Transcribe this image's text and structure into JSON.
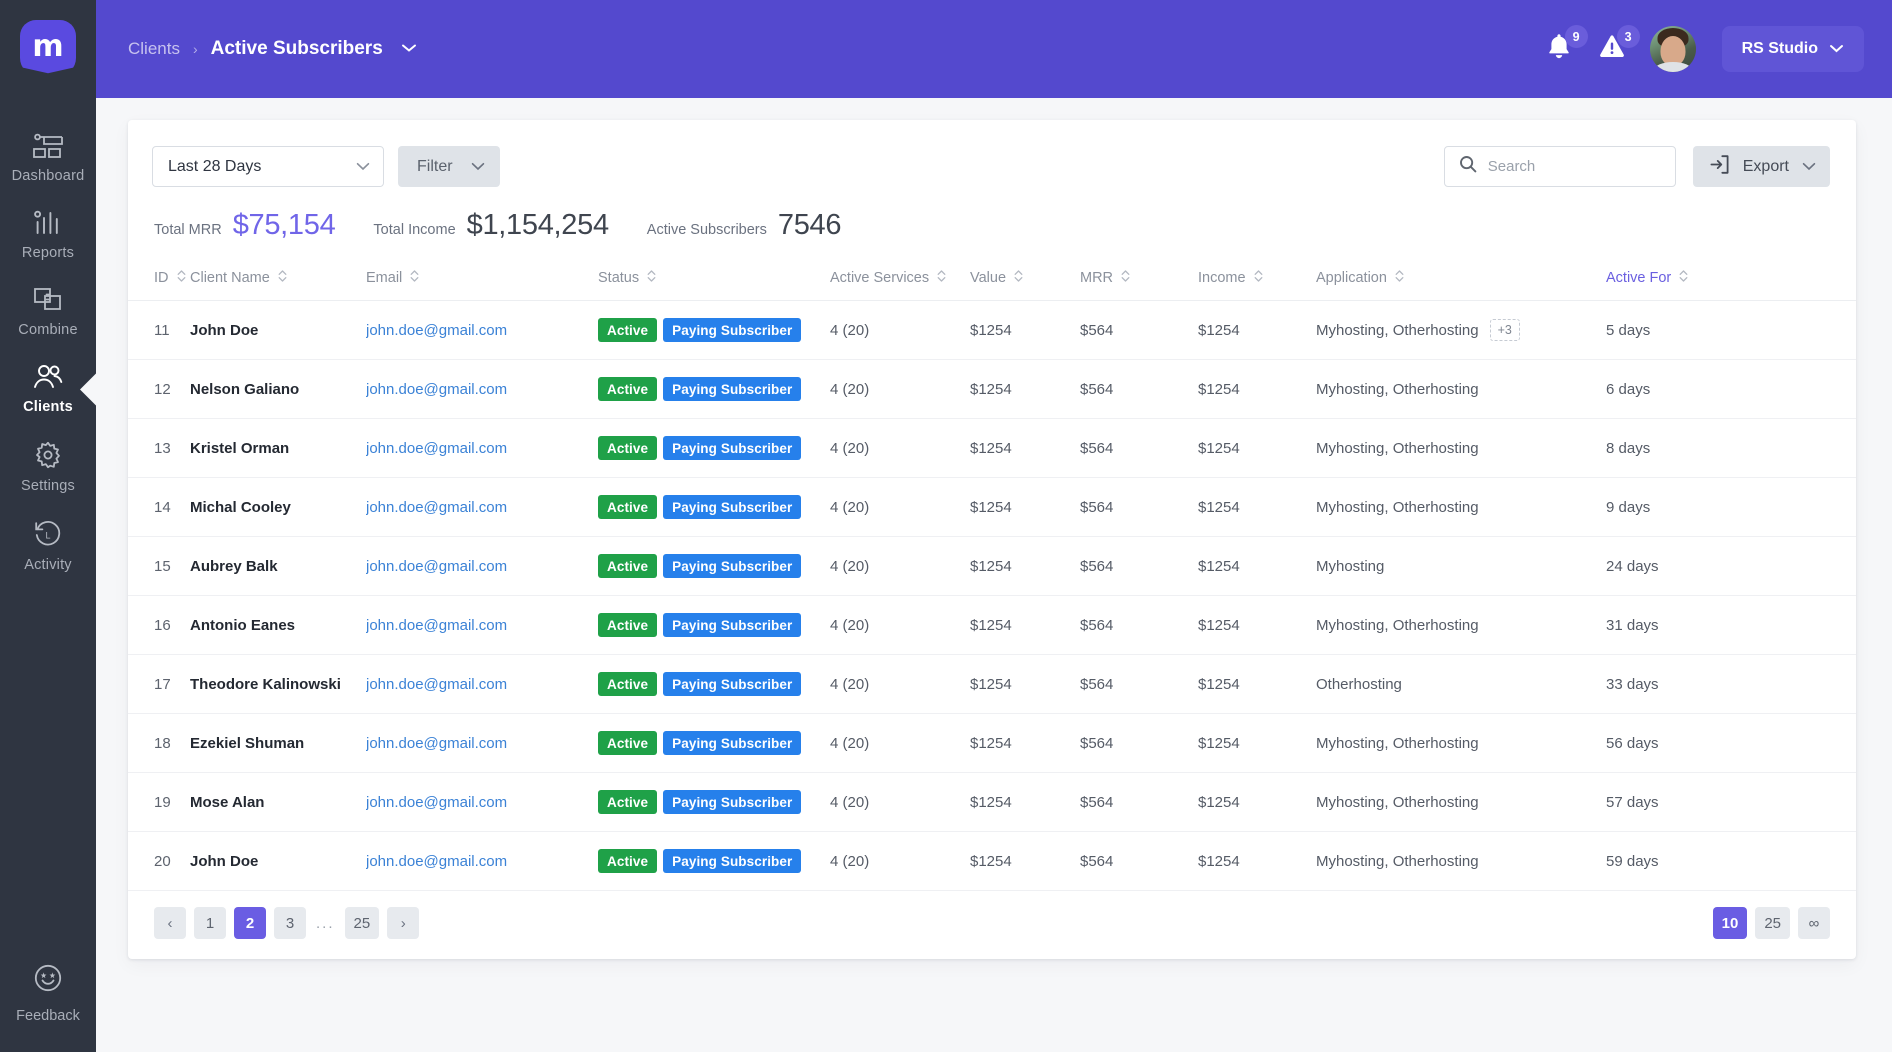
{
  "sidebar": {
    "logo_letter": "m",
    "items": [
      {
        "label": "Dashboard",
        "icon": "dashboard-icon",
        "active": false
      },
      {
        "label": "Reports",
        "icon": "reports-icon",
        "active": false
      },
      {
        "label": "Combine",
        "icon": "combine-icon",
        "active": false
      },
      {
        "label": "Clients",
        "icon": "clients-icon",
        "active": true
      },
      {
        "label": "Settings",
        "icon": "settings-gear-icon",
        "active": false
      },
      {
        "label": "Activity",
        "icon": "activity-history-icon",
        "active": false
      }
    ],
    "feedback": {
      "label": "Feedback",
      "icon": "feedback-smiley-icon"
    }
  },
  "topbar": {
    "breadcrumb_root": "Clients",
    "breadcrumb_separator": "›",
    "breadcrumb_current": "Active Subscribers",
    "notifications_count": "9",
    "alerts_count": "3",
    "workspace": "RS Studio",
    "accent_color": "#5449ce"
  },
  "toolbar": {
    "date_range": "Last 28 Days",
    "filter_label": "Filter",
    "search_placeholder": "Search",
    "search_value": "",
    "export_label": "Export"
  },
  "stats": [
    {
      "key": "Total MRR",
      "value": "$75,154",
      "accent": true
    },
    {
      "key": "Total Income",
      "value": "$1,154,254",
      "accent": false
    },
    {
      "key": "Active Subscribers",
      "value": "7546",
      "accent": false
    }
  ],
  "table": {
    "columns": [
      {
        "label": "ID",
        "sortable": true,
        "highlight": false
      },
      {
        "label": "Client Name",
        "sortable": true,
        "highlight": false
      },
      {
        "label": "Email",
        "sortable": true,
        "highlight": false
      },
      {
        "label": "Status",
        "sortable": true,
        "highlight": false
      },
      {
        "label": "Active Services",
        "sortable": true,
        "highlight": false
      },
      {
        "label": "Value",
        "sortable": true,
        "highlight": false
      },
      {
        "label": "MRR",
        "sortable": true,
        "highlight": false
      },
      {
        "label": "Income",
        "sortable": true,
        "highlight": false
      },
      {
        "label": "Application",
        "sortable": true,
        "highlight": false
      },
      {
        "label": "Active For",
        "sortable": true,
        "highlight": true
      }
    ],
    "rows": [
      {
        "id": "11",
        "name": "John Doe",
        "email": "john.doe@gmail.com",
        "status": "Active",
        "plan": "Paying Subscriber",
        "services": "4 (20)",
        "value": "$1254",
        "mrr": "$564",
        "income": "$1254",
        "application": "Myhosting, Otherhosting",
        "more": "+3",
        "active_for": "5 days"
      },
      {
        "id": "12",
        "name": "Nelson Galiano",
        "email": "john.doe@gmail.com",
        "status": "Active",
        "plan": "Paying Subscriber",
        "services": "4 (20)",
        "value": "$1254",
        "mrr": "$564",
        "income": "$1254",
        "application": "Myhosting, Otherhosting",
        "more": "",
        "active_for": "6 days"
      },
      {
        "id": "13",
        "name": "Kristel Orman",
        "email": "john.doe@gmail.com",
        "status": "Active",
        "plan": "Paying Subscriber",
        "services": "4 (20)",
        "value": "$1254",
        "mrr": "$564",
        "income": "$1254",
        "application": "Myhosting, Otherhosting",
        "more": "",
        "active_for": "8 days"
      },
      {
        "id": "14",
        "name": "Michal Cooley",
        "email": "john.doe@gmail.com",
        "status": "Active",
        "plan": "Paying Subscriber",
        "services": "4 (20)",
        "value": "$1254",
        "mrr": "$564",
        "income": "$1254",
        "application": "Myhosting, Otherhosting",
        "more": "",
        "active_for": "9 days"
      },
      {
        "id": "15",
        "name": "Aubrey Balk",
        "email": "john.doe@gmail.com",
        "status": "Active",
        "plan": "Paying Subscriber",
        "services": "4 (20)",
        "value": "$1254",
        "mrr": "$564",
        "income": "$1254",
        "application": "Myhosting",
        "more": "",
        "active_for": "24 days"
      },
      {
        "id": "16",
        "name": "Antonio Eanes",
        "email": "john.doe@gmail.com",
        "status": "Active",
        "plan": "Paying Subscriber",
        "services": "4 (20)",
        "value": "$1254",
        "mrr": "$564",
        "income": "$1254",
        "application": "Myhosting, Otherhosting",
        "more": "",
        "active_for": "31 days"
      },
      {
        "id": "17",
        "name": "Theodore Kalinowski",
        "email": "john.doe@gmail.com",
        "status": "Active",
        "plan": "Paying Subscriber",
        "services": "4 (20)",
        "value": "$1254",
        "mrr": "$564",
        "income": "$1254",
        "application": "Otherhosting",
        "more": "",
        "active_for": "33 days"
      },
      {
        "id": "18",
        "name": "Ezekiel Shuman",
        "email": "john.doe@gmail.com",
        "status": "Active",
        "plan": "Paying Subscriber",
        "services": "4 (20)",
        "value": "$1254",
        "mrr": "$564",
        "income": "$1254",
        "application": "Myhosting, Otherhosting",
        "more": "",
        "active_for": "56 days"
      },
      {
        "id": "19",
        "name": "Mose Alan",
        "email": "john.doe@gmail.com",
        "status": "Active",
        "plan": "Paying Subscriber",
        "services": "4 (20)",
        "value": "$1254",
        "mrr": "$564",
        "income": "$1254",
        "application": "Myhosting, Otherhosting",
        "more": "",
        "active_for": "57 days"
      },
      {
        "id": "20",
        "name": "John Doe",
        "email": "john.doe@gmail.com",
        "status": "Active",
        "plan": "Paying Subscriber",
        "services": "4 (20)",
        "value": "$1254",
        "mrr": "$564",
        "income": "$1254",
        "application": "Myhosting, Otherhosting",
        "more": "",
        "active_for": "59 days"
      }
    ]
  },
  "pagination": {
    "prev": "‹",
    "next": "›",
    "pages": [
      "1",
      "2",
      "3"
    ],
    "ellipsis": "...",
    "last_page": "25",
    "current_page": "2",
    "page_sizes": [
      "10",
      "25",
      "∞"
    ],
    "current_size": "10"
  },
  "colors": {
    "header_purple": "#5449ce",
    "sidebar_dark": "#2f3541",
    "accent": "#6a5de3",
    "status_green": "#1fa148",
    "status_blue": "#2680eb",
    "page_bg": "#f6f7f9"
  }
}
